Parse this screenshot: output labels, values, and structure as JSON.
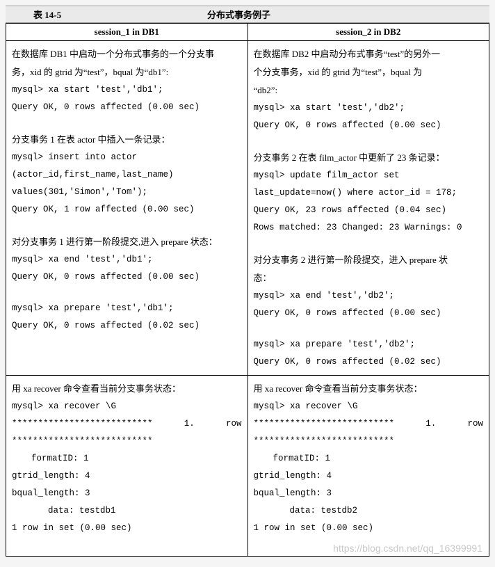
{
  "caption": {
    "left": "表 14-5",
    "center": "分布式事务例子"
  },
  "headers": {
    "col1": "session_1 in DB1",
    "col2": "session_2 in DB2"
  },
  "r1c1": {
    "l1": "在数据库 DB1 中启动一个分布式事务的一个分支事",
    "l2": "务，xid 的 gtrid 为“test”，bqual 为“db1”:",
    "l3": "mysql> xa start 'test','db1';",
    "l4": "Query OK, 0 rows affected (0.00 sec)",
    "l5": "分支事务 1 在表 actor 中插入一条记录：",
    "l6": "mysql> insert into actor",
    "l7": "(actor_id,first_name,last_name)",
    "l8": "values(301,'Simon','Tom');",
    "l9": "Query OK, 1 row affected (0.00 sec)",
    "l10": "对分支事务 1 进行第一阶段提交,进入 prepare 状态：",
    "l11": "mysql> xa end 'test','db1';",
    "l12": "Query OK, 0 rows affected (0.00 sec)",
    "l13": "mysql> xa prepare 'test','db1';",
    "l14": "Query OK, 0 rows affected (0.02 sec)"
  },
  "r1c2": {
    "l1": "在数据库 DB2 中启动分布式事务“test”的另外一",
    "l2": "个分支事务，xid 的 gtrid 为“test”，bqual 为",
    "l3": "“db2”:",
    "l4": "mysql> xa start 'test','db2';",
    "l5": "Query OK, 0 rows affected (0.00 sec)",
    "l6": "分支事务 2 在表 film_actor 中更新了 23 条记录：",
    "l7": "mysql> update film_actor set",
    "l8": "last_update=now() where actor_id = 178;",
    "l9": "Query OK, 23 rows affected (0.04 sec)",
    "l10": "Rows matched: 23  Changed: 23  Warnings: 0",
    "l11": "对分支事务 2 进行第一阶段提交，进入 prepare 状",
    "l12": "态：",
    "l13": "mysql> xa end 'test','db2';",
    "l14": "Query OK, 0 rows affected (0.00 sec)",
    "l15": "mysql> xa prepare 'test','db2';",
    "l16": "Query OK, 0 rows affected (0.02 sec)"
  },
  "r2c1": {
    "l1": "用 xa recover 命令查看当前分支事务状态：",
    "l2": "mysql> xa recover \\G",
    "aster": "***************************",
    "one": "1.",
    "row": "row",
    "aster2": "***************************",
    "l3": "formatID: 1",
    "l4": "gtrid_length: 4",
    "l5": "bqual_length: 3",
    "l6": "data: testdb1",
    "l7": "1 row in set (0.00 sec)"
  },
  "r2c2": {
    "l1": "用 xa recover 命令查看当前分支事务状态：",
    "l2": "mysql> xa recover \\G",
    "aster": "***************************",
    "one": "1.",
    "row": "row",
    "aster2": "***************************",
    "l3": "formatID: 1",
    "l4": "gtrid_length: 4",
    "l5": "bqual_length: 3",
    "l6": "data: testdb2",
    "l7": "1 row in set (0.00 sec)"
  },
  "watermark": "https://blog.csdn.net/qq_16399991"
}
